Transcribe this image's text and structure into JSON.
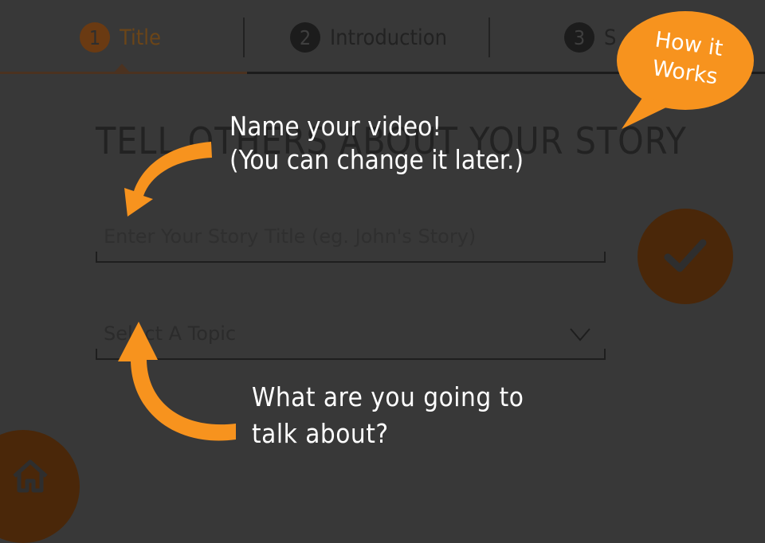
{
  "steps": [
    {
      "number": "1",
      "label": "Title",
      "state": "active"
    },
    {
      "number": "2",
      "label": "Introduction",
      "state": "inactive"
    },
    {
      "number": "3",
      "label": "S",
      "state": "inactive"
    }
  ],
  "form": {
    "heading": "TELL OTHERS ABOUT YOUR STORY",
    "title_field": {
      "value": "",
      "placeholder": "Enter Your Story Title (eg. John's Story)"
    },
    "topic_select": {
      "selected": "Select A Topic"
    }
  },
  "help": {
    "bubble_line1": "How it",
    "bubble_line2": "Works",
    "tip_name_line1": "Name your video!",
    "tip_name_line2": "(You can change it later.)",
    "tip_topic_line1": "What are you going to",
    "tip_topic_line2": "talk about?"
  },
  "icons": {
    "submit": "checkmark-icon",
    "home": "home-icon",
    "select": "chevron-down-icon",
    "tip_arrows": "arrow-icon"
  },
  "colors": {
    "background": "#383838",
    "accent": "#f7931e",
    "accent_dim": "#4a2709",
    "tip_text": "#ffffff"
  }
}
